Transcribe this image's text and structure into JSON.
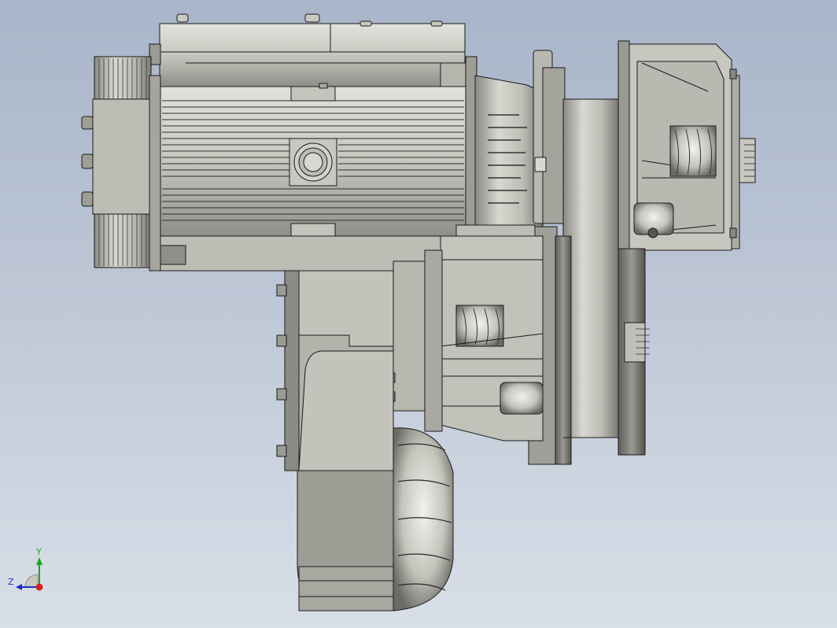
{
  "viewport": {
    "background_top": "#a9b5c9",
    "background_bottom": "#d9dfe8"
  },
  "model": {
    "part_fill": "#c9c9c1",
    "part_dark": "#7e7e78",
    "edge_color": "#1a1a1a"
  },
  "triad": {
    "y_label": "Y",
    "z_label": "Z",
    "y_color": "#1ca81c",
    "z_color": "#1c2fc4",
    "x_color": "#d42020"
  }
}
